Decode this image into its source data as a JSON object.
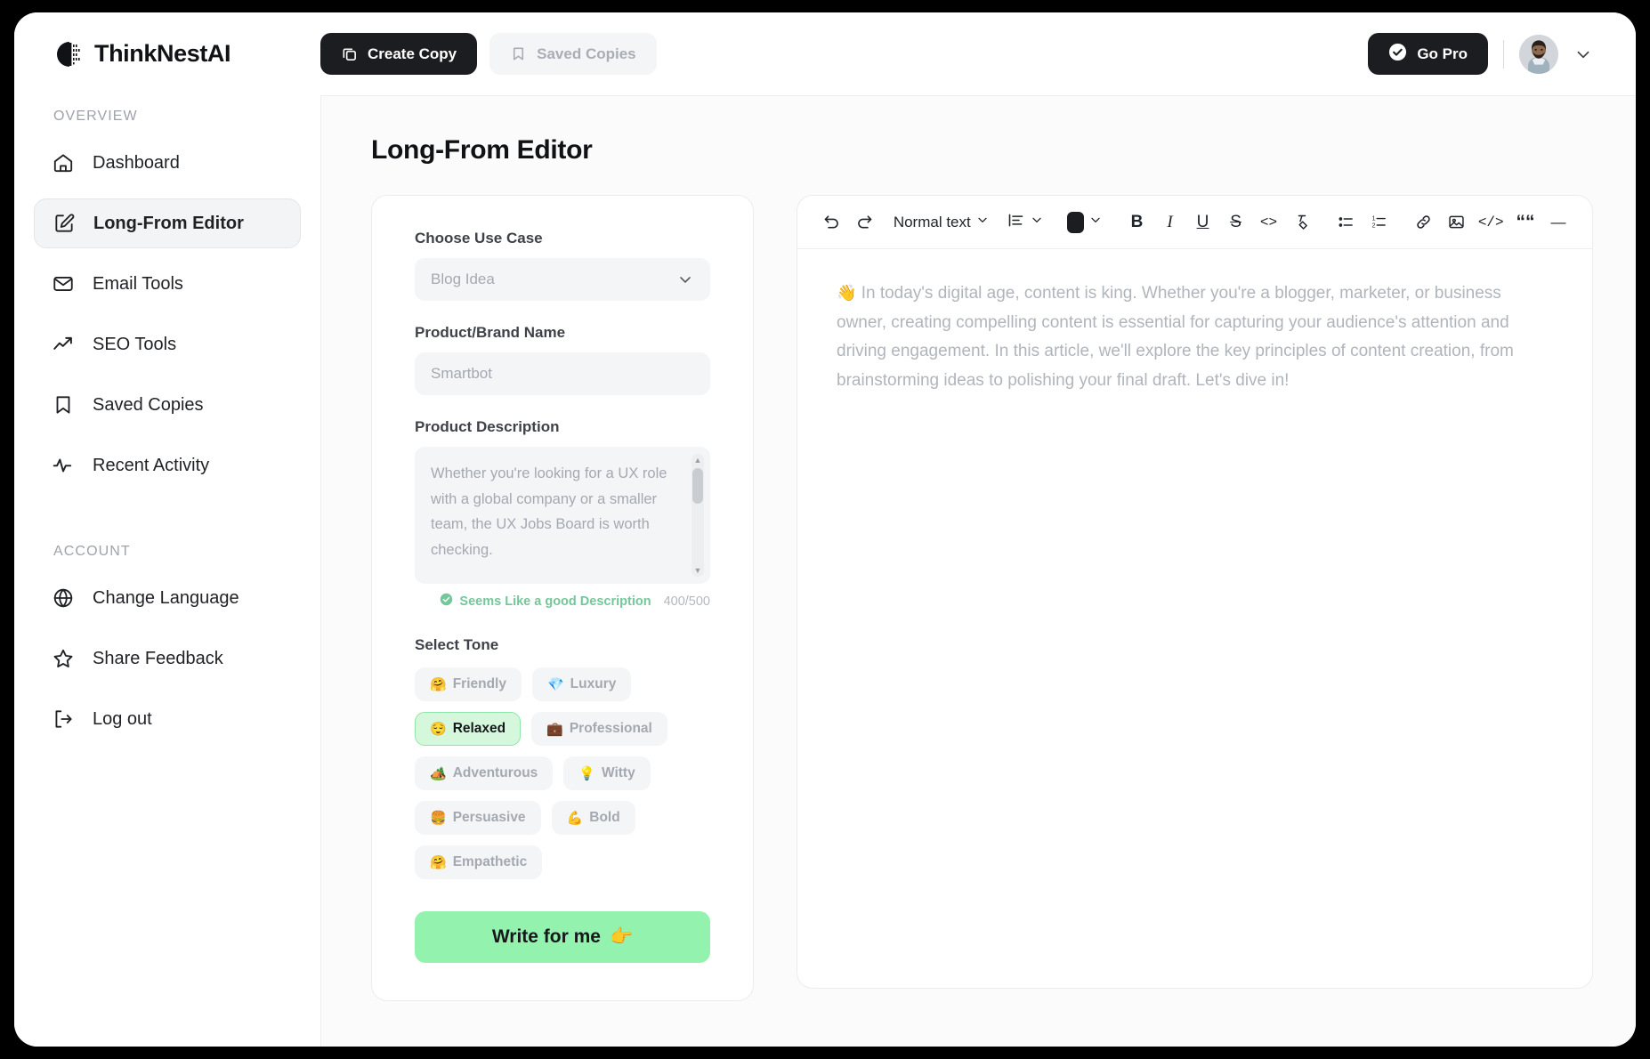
{
  "brand": {
    "name": "ThinkNestAI",
    "logo_icon": "book-mark-logo-icon"
  },
  "topbar": {
    "tabs": [
      {
        "label": "Create Copy",
        "icon": "copy-icon",
        "active": true
      },
      {
        "label": "Saved Copies",
        "icon": "bookmark-icon",
        "active": false
      }
    ],
    "go_pro_label": "Go Pro",
    "go_pro_icon": "check-circle-icon",
    "avatar_icon": "user-avatar",
    "chevron_icon": "chevron-down-icon"
  },
  "sidebar": {
    "sections": [
      {
        "label": "OVERVIEW",
        "items": [
          {
            "label": "Dashboard",
            "icon": "home-icon",
            "active": false
          },
          {
            "label": "Long-From Editor",
            "icon": "edit-square-icon",
            "active": true
          },
          {
            "label": "Email Tools",
            "icon": "mail-icon",
            "active": false
          },
          {
            "label": "SEO Tools",
            "icon": "trending-up-icon",
            "active": false
          },
          {
            "label": "Saved Copies",
            "icon": "bookmark-icon",
            "active": false
          },
          {
            "label": "Recent Activity",
            "icon": "activity-pulse-icon",
            "active": false
          }
        ]
      },
      {
        "label": "ACCOUNT",
        "items": [
          {
            "label": "Change Language",
            "icon": "globe-icon",
            "active": false
          },
          {
            "label": "Share Feedback",
            "icon": "star-icon",
            "active": false
          },
          {
            "label": "Log out",
            "icon": "logout-icon",
            "active": false
          }
        ]
      }
    ]
  },
  "main": {
    "page_title": "Long-From Editor",
    "form": {
      "use_case": {
        "label": "Choose Use Case",
        "value": "Blog Idea",
        "chevron_icon": "chevron-down-icon"
      },
      "brand_name": {
        "label": "Product/Brand Name",
        "value": "Smartbot",
        "placeholder": "Smartbot"
      },
      "description": {
        "label": "Product Description",
        "value": "Whether you're looking for a UX role with a global company or a smaller team, the UX Jobs Board is worth checking.",
        "helper_text": "Seems Like a good Description",
        "helper_icon": "check-badge-icon",
        "counter": "400/500"
      },
      "tone": {
        "label": "Select Tone",
        "options": [
          {
            "label": "Friendly",
            "emoji": "🤗",
            "selected": false
          },
          {
            "label": "Luxury",
            "emoji": "💎",
            "selected": false
          },
          {
            "label": "Relaxed",
            "emoji": "😌",
            "selected": true
          },
          {
            "label": "Professional",
            "emoji": "💼",
            "selected": false
          },
          {
            "label": "Adventurous",
            "emoji": "🏕️",
            "selected": false
          },
          {
            "label": "Witty",
            "emoji": "💡",
            "selected": false
          },
          {
            "label": "Persuasive",
            "emoji": "🍔",
            "selected": false
          },
          {
            "label": "Bold",
            "emoji": "💪",
            "selected": false
          },
          {
            "label": "Empathetic",
            "emoji": "🤗",
            "selected": false
          }
        ]
      },
      "submit": {
        "label": "Write for me",
        "emoji": "👉"
      }
    },
    "editor": {
      "toolbar": {
        "undo_icon": "undo-icon",
        "redo_icon": "redo-icon",
        "text_style": "Normal text",
        "text_style_chevron": "chevron-down-icon",
        "align_icon": "align-left-icon",
        "align_chevron": "chevron-down-icon",
        "color_swatch": "#1c1d20",
        "color_chevron": "chevron-down-icon",
        "bold": "B",
        "italic": "I",
        "underline": "U",
        "strikethrough": "S",
        "inline_code": "<>",
        "clear_format_icon": "clear-formatting-icon",
        "bullet_list_icon": "bullet-list-icon",
        "numbered_list_icon": "numbered-list-icon",
        "link_icon": "link-icon",
        "image_icon": "image-icon",
        "code_block": "</>",
        "blockquote": "““",
        "horizontal_rule": "—"
      },
      "content_emoji": "👋",
      "content": "In today's digital age, content is king. Whether you're a blogger, marketer, or business owner, creating compelling content is essential for capturing your audience's attention and driving engagement. In this article, we'll explore the key principles of content creation, from brainstorming ideas to polishing your final draft. Let's dive in!"
    }
  },
  "colors": {
    "accent_green": "#93f2ad",
    "selected_chip_bg": "#d5f8dd",
    "dark": "#1c1d20",
    "muted_text": "#a4a9b1"
  }
}
